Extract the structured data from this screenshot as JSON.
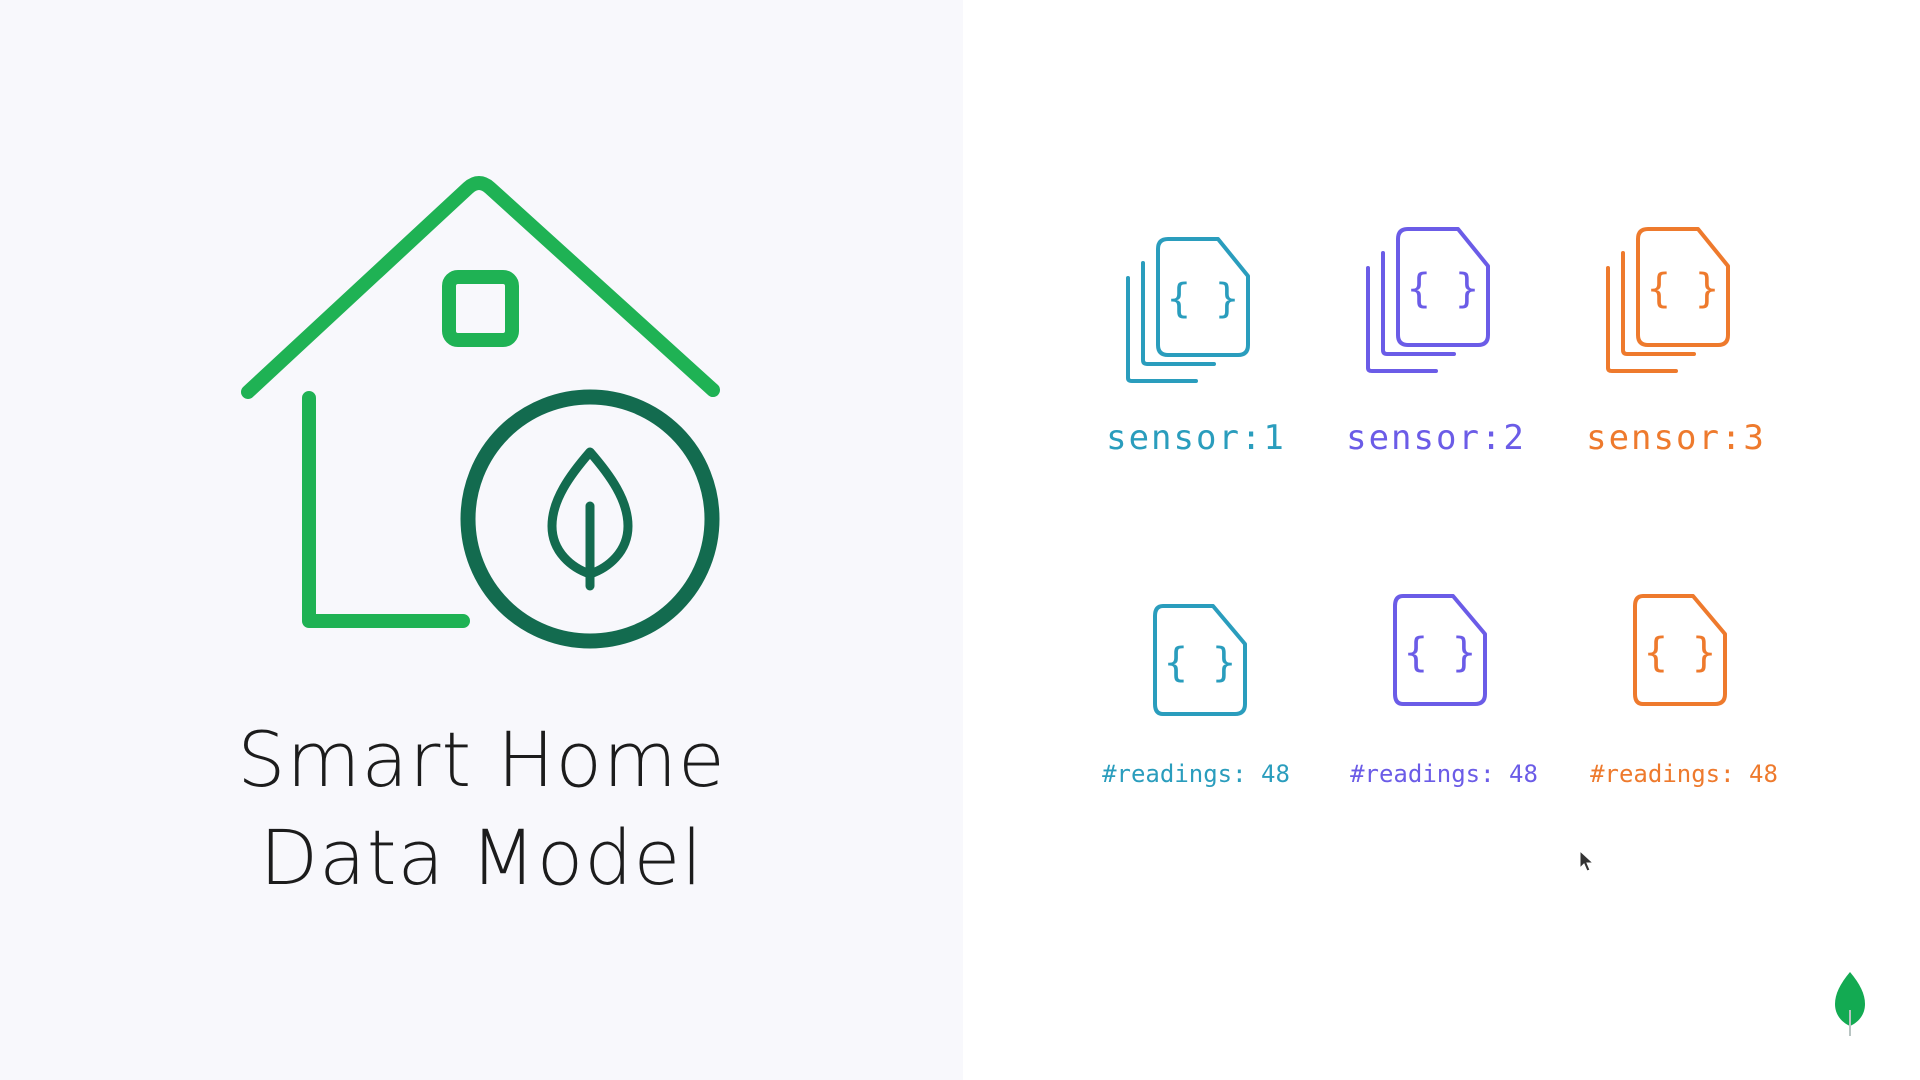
{
  "slide": {
    "title_line1": "Smart Home",
    "title_line2": "Data Model"
  },
  "colors": {
    "house_green": "#1fb254",
    "circle_dark_green": "#136b4f",
    "sensor1": "#2a9dbd",
    "sensor2": "#6b5ce7",
    "sensor3": "#ee7a2d",
    "logo_green": "#13aa52"
  },
  "sensors": [
    {
      "label": "sensor:1",
      "readings": "#readings: 48",
      "brace": "{ }"
    },
    {
      "label": "sensor:2",
      "readings": "#readings: 48",
      "brace": "{ }"
    },
    {
      "label": "sensor:3",
      "readings": "#readings: 48",
      "brace": "{ }"
    }
  ],
  "icons": {
    "house": "house-icon",
    "leaf": "leaf-icon",
    "collection": "document-stack-icon",
    "document": "document-icon",
    "logo": "mongodb-leaf-logo",
    "cursor": "mouse-cursor"
  }
}
